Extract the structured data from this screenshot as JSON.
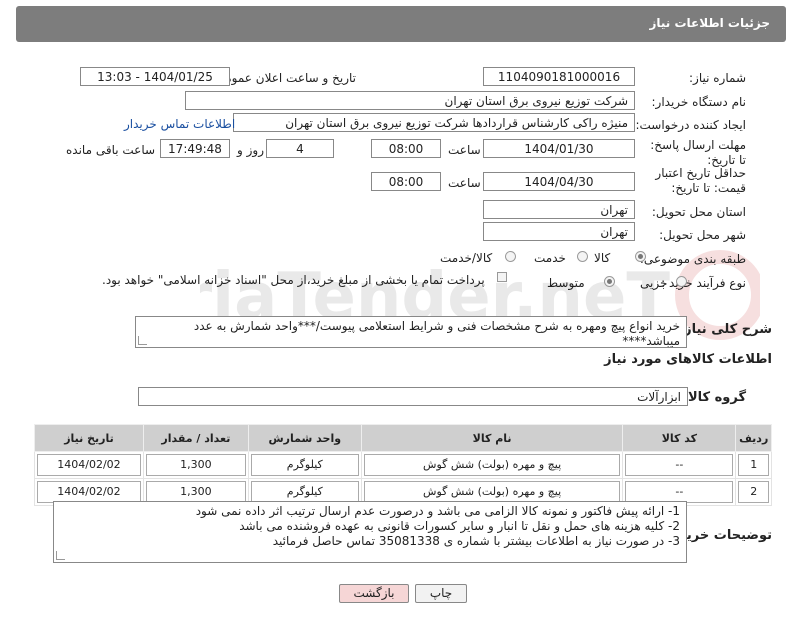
{
  "header": {
    "title": "جزئیات اطلاعات نیاز"
  },
  "form": {
    "need_number_label": "شماره نیاز:",
    "need_number": "1104090181000016",
    "announce_label": "تاریخ و ساعت اعلان عمومی:",
    "announce_value": "1404/01/25 - 13:03",
    "buyer_label": "نام دستگاه خریدار:",
    "buyer_value": "شرکت توزیع نیروی برق استان تهران",
    "creator_label": "ایجاد کننده درخواست:",
    "creator_value": "منیژه راکی کارشناس قراردادها شرکت توزیع نیروی برق استان تهران",
    "contact_link": "اطلاعات تماس خریدار",
    "deadline_label": "مهلت ارسال پاسخ: تا تاریخ:",
    "deadline_date": "1404/01/30",
    "hour_label": "ساعت",
    "deadline_time": "08:00",
    "days_value": "4",
    "days_label": "روز و",
    "remaining_time": "17:49:48",
    "remaining_label": "ساعت باقی مانده",
    "validity_label": "حداقل تاریخ اعتبار قیمت: تا تاریخ:",
    "validity_date": "1404/04/30",
    "validity_time": "08:00",
    "province_label": "استان محل تحویل:",
    "province_value": "تهران",
    "city_label": "شهر محل تحویل:",
    "city_value": "تهران",
    "category_label": "طبقه بندی موضوعی:",
    "category_options": [
      "کالا",
      "خدمت",
      "کالا/خدمت"
    ],
    "process_label": "نوع فرآیند خرید :",
    "process_options": [
      "جزیی",
      "متوسط"
    ],
    "payment_note": "پرداخت تمام یا بخشی از مبلغ خرید،از محل \"اسناد خزانه اسلامی\" خواهد بود."
  },
  "description": {
    "label": "شرح کلی نیاز:",
    "text": "خرید انواع پیچ ومهره  به شرح مشخصات فنی و شرایط استعلامی پیوست/***واحد شمارش به عدد میباشد****"
  },
  "goods": {
    "section_title": "اطلاعات کالاهای مورد نیاز",
    "group_label": "گروه کالا:",
    "group_value": "ابزارآلات",
    "columns": [
      "ردیف",
      "کد کالا",
      "نام کالا",
      "واحد شمارش",
      "تعداد / مقدار",
      "تاریخ نیاز"
    ],
    "rows": [
      [
        "1",
        "--",
        "پیچ و مهره (بولت) شش گوش",
        "کیلوگرم",
        "1,300",
        "1404/02/02"
      ],
      [
        "2",
        "--",
        "پیچ و مهره (بولت) شش گوش",
        "کیلوگرم",
        "1,300",
        "1404/02/02"
      ]
    ]
  },
  "buyer_notes": {
    "label": "توضیحات خریدار:",
    "lines": [
      "1- ارائه پیش فاکتور و نمونه کالا الزامی می باشد و درصورت عدم ارسال ترتیب اثر داده نمی شود",
      "2- کلیه هزینه های حمل و نقل تا انبار و سایر کسورات قانونی به عهده فروشنده می باشد",
      "3- در صورت نیاز به اطلاعات بیشتر با شماره ی 35081338 تماس حاصل فرمائید"
    ]
  },
  "buttons": {
    "print": "چاپ",
    "back": "بازگشت"
  },
  "watermark_text": "AriaTender.neT",
  "colors": {
    "header_bg": "#7d7d7d",
    "link": "#1a4fa0",
    "back_button_bg": "#f6d6d6"
  }
}
